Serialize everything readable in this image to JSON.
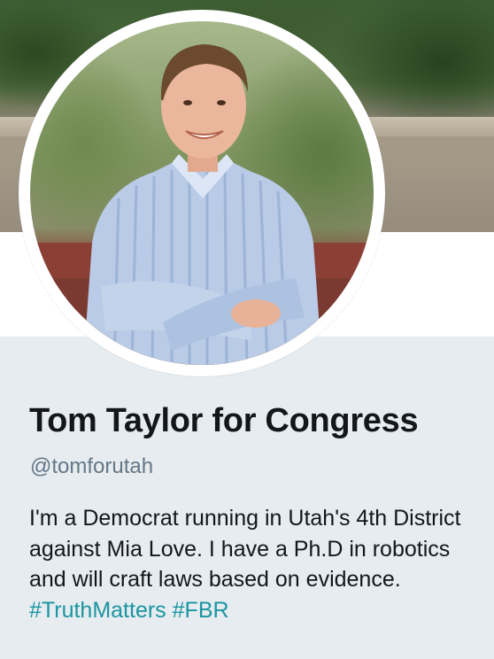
{
  "profile": {
    "name": "Tom Taylor for Congress",
    "handle": "@tomforutah",
    "bio_text": "I'm a Democrat running in Utah's 4th District against Mia Love. I have a Ph.D in robotics and will craft laws based on evidence.",
    "hashtags": [
      "#TruthMatters",
      "#FBR"
    ]
  },
  "colors": {
    "background": "#e6ecf0",
    "name": "#14171a",
    "handle": "#657786",
    "hashtag": "#1b95a0"
  }
}
